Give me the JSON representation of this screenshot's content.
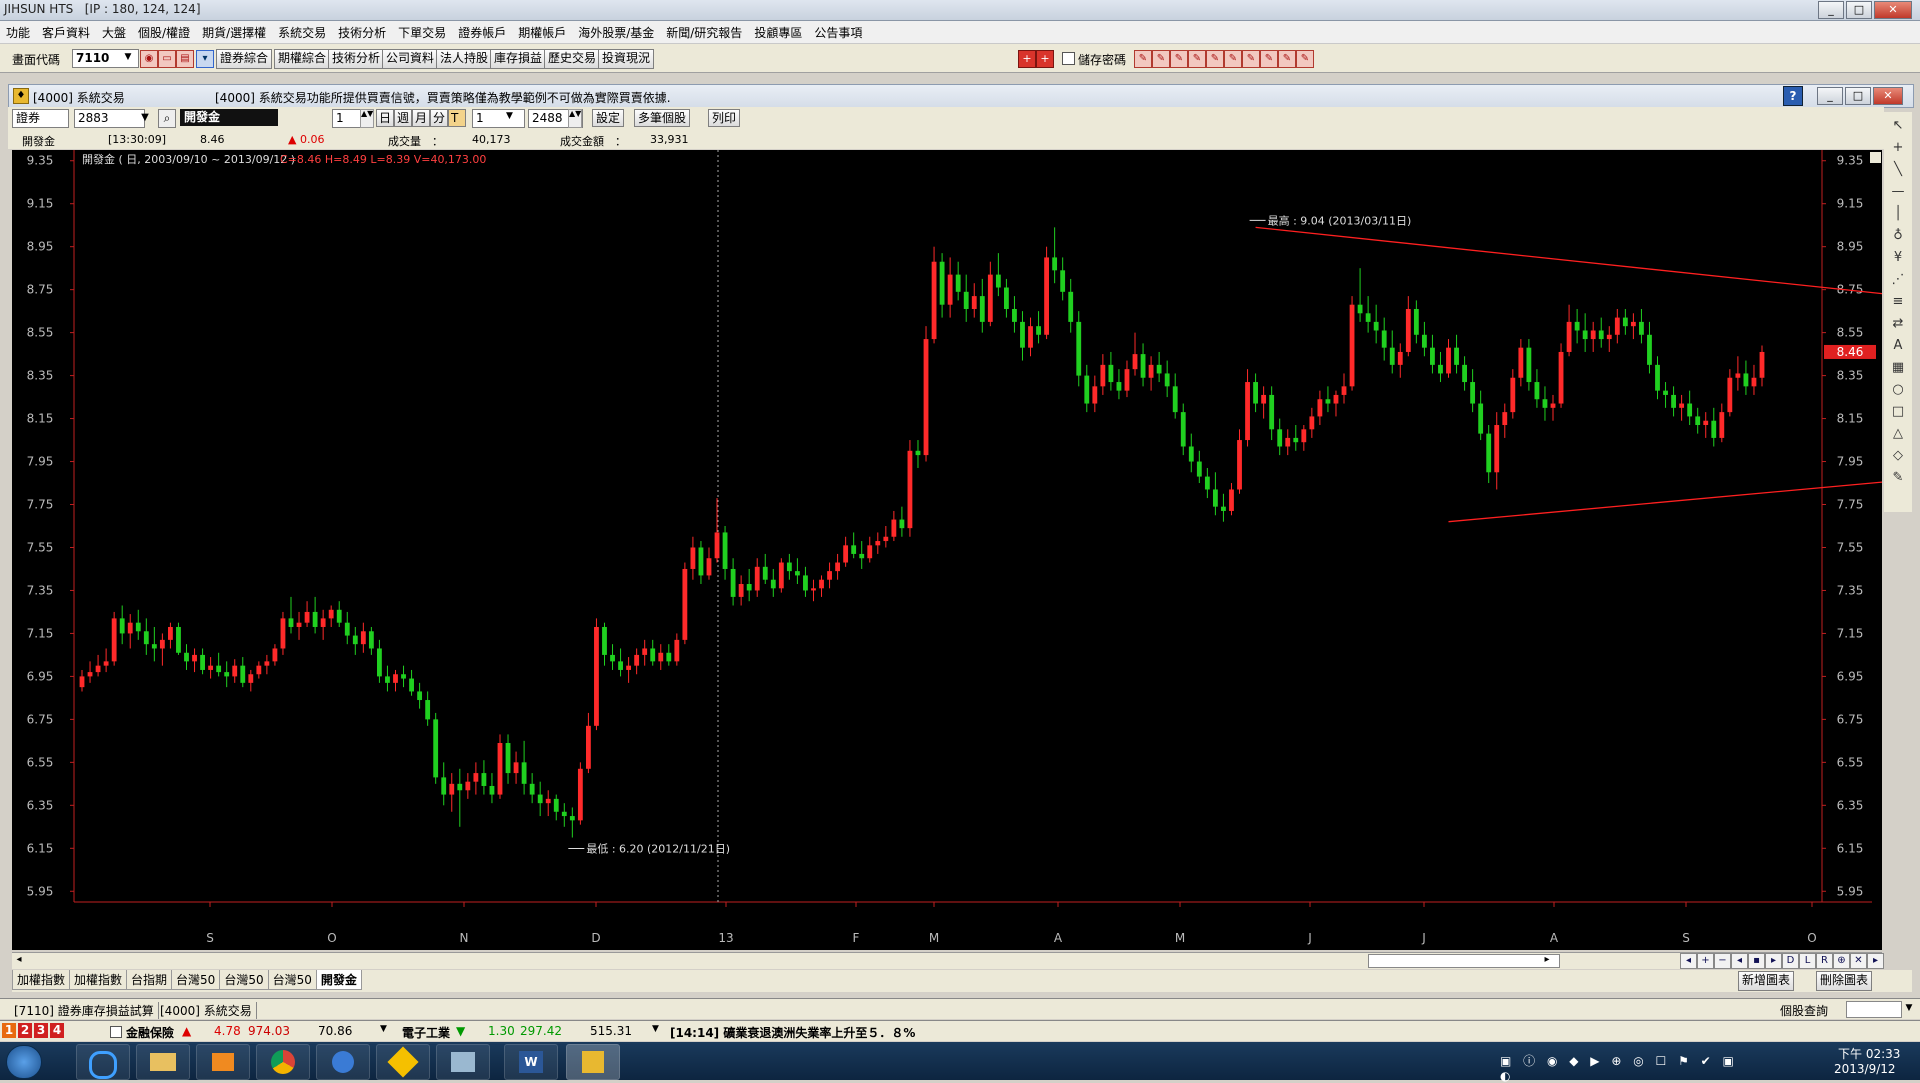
{
  "app": {
    "title": "JIHSUN HTS",
    "ip": "[IP : 180, 124, 124]"
  },
  "menu": [
    "功能",
    "客戶資料",
    "大盤",
    "個股/權證",
    "期貨/選擇權",
    "系統交易",
    "技術分析",
    "下單交易",
    "證券帳戶",
    "期權帳戶",
    "海外股票/基金",
    "新聞/研究報告",
    "投顧專區",
    "公告事項"
  ],
  "toolbar1": {
    "code_label": "畫面代碼",
    "code_value": "7110",
    "buttons": [
      "證券綜合",
      "期權綜合",
      "技術分析",
      "公司資料",
      "法人持股",
      "庫存損益",
      "歷史交易",
      "投資現況"
    ],
    "save_pwd": "儲存密碼"
  },
  "subwindow": {
    "title": "[4000] 系統交易",
    "notice": "[4000] 系統交易功能所提供買賣信號，買賣策略僅為教學範例不可做為實際買賣依據."
  },
  "toolbar2": {
    "market": "證券",
    "stock_code": "2883",
    "stock_name": "開發金",
    "period_value": "1",
    "period_buttons": [
      "日",
      "週",
      "月",
      "分",
      "T"
    ],
    "count_value": "1",
    "bars_value": "2488",
    "buttons": [
      "設定",
      "多筆個股",
      "列印"
    ]
  },
  "info": {
    "name": "開發金",
    "time": "[13:30:09]",
    "price": "8.46",
    "change": "▲ 0.06",
    "vol_label": "成交量　：",
    "vol_value": "40,173",
    "amt_label": "成交金額　：",
    "amt_value": "33,931"
  },
  "chart_data": {
    "type": "candlestick",
    "title": "開發金 ( 日, 2003/09/10 ~ 2013/09/12 )",
    "ohlc_text": "C=8.46 H=8.49 L=8.39 V=40,173.00",
    "yticks": [
      "9.35",
      "9.15",
      "8.95",
      "8.75",
      "8.55",
      "8.35",
      "8.15",
      "7.95",
      "7.75",
      "7.55",
      "7.35",
      "7.15",
      "6.95",
      "6.75",
      "6.55",
      "6.35",
      "6.15",
      "5.95"
    ],
    "ylim": [
      5.9,
      9.4
    ],
    "xticks": [
      "S",
      "O",
      "N",
      "D",
      "13",
      "F",
      "M",
      "A",
      "M",
      "J",
      "J",
      "A",
      "S",
      "O"
    ],
    "last_price": "8.46",
    "high_note": "最高 : 9.04 (2013/03/11日)",
    "low_note": "最低 : 6.20 (2012/11/21日)",
    "colors": {
      "up": "#ff2a2a",
      "down": "#20d020",
      "trend": "#ff2020",
      "axis": "#c02020"
    },
    "trendlines": [
      {
        "from": {
          "i": 146,
          "v": 9.04
        },
        "to": {
          "i": 290,
          "v": 8.47
        }
      },
      {
        "from": {
          "i": 170,
          "v": 7.67
        },
        "to": {
          "i": 290,
          "v": 8.08
        }
      }
    ],
    "candles": [
      [
        6.9,
        6.98,
        6.88,
        6.95
      ],
      [
        6.95,
        7.02,
        6.92,
        6.97
      ],
      [
        6.97,
        7.05,
        6.95,
        7.0
      ],
      [
        7.0,
        7.08,
        6.97,
        7.02
      ],
      [
        7.02,
        7.25,
        7.0,
        7.22
      ],
      [
        7.22,
        7.28,
        7.1,
        7.15
      ],
      [
        7.15,
        7.24,
        7.08,
        7.2
      ],
      [
        7.2,
        7.26,
        7.12,
        7.16
      ],
      [
        7.16,
        7.22,
        7.05,
        7.1
      ],
      [
        7.1,
        7.18,
        7.02,
        7.08
      ],
      [
        7.08,
        7.15,
        7.0,
        7.12
      ],
      [
        7.12,
        7.2,
        7.08,
        7.18
      ],
      [
        7.18,
        7.2,
        7.05,
        7.06
      ],
      [
        7.06,
        7.1,
        6.98,
        7.02
      ],
      [
        7.02,
        7.08,
        6.97,
        7.05
      ],
      [
        7.05,
        7.08,
        6.96,
        6.98
      ],
      [
        6.98,
        7.04,
        6.94,
        7.0
      ],
      [
        7.0,
        7.06,
        6.95,
        6.97
      ],
      [
        6.97,
        7.02,
        6.9,
        6.95
      ],
      [
        6.95,
        7.03,
        6.92,
        7.0
      ],
      [
        7.0,
        7.04,
        6.9,
        6.92
      ],
      [
        6.92,
        6.98,
        6.88,
        6.96
      ],
      [
        6.96,
        7.02,
        6.94,
        7.0
      ],
      [
        7.0,
        7.05,
        6.96,
        7.02
      ],
      [
        7.02,
        7.1,
        7.0,
        7.08
      ],
      [
        7.08,
        7.25,
        7.05,
        7.22
      ],
      [
        7.22,
        7.32,
        7.15,
        7.18
      ],
      [
        7.18,
        7.25,
        7.12,
        7.2
      ],
      [
        7.2,
        7.3,
        7.18,
        7.25
      ],
      [
        7.25,
        7.32,
        7.15,
        7.18
      ],
      [
        7.18,
        7.26,
        7.12,
        7.22
      ],
      [
        7.22,
        7.28,
        7.18,
        7.26
      ],
      [
        7.26,
        7.3,
        7.18,
        7.2
      ],
      [
        7.2,
        7.25,
        7.1,
        7.14
      ],
      [
        7.14,
        7.18,
        7.05,
        7.1
      ],
      [
        7.1,
        7.2,
        7.06,
        7.16
      ],
      [
        7.16,
        7.18,
        7.05,
        7.08
      ],
      [
        7.08,
        7.12,
        6.92,
        6.95
      ],
      [
        6.95,
        7.0,
        6.88,
        6.92
      ],
      [
        6.92,
        6.98,
        6.88,
        6.96
      ],
      [
        6.96,
        7.0,
        6.9,
        6.94
      ],
      [
        6.94,
        6.98,
        6.86,
        6.88
      ],
      [
        6.88,
        6.92,
        6.8,
        6.84
      ],
      [
        6.84,
        6.88,
        6.72,
        6.75
      ],
      [
        6.75,
        6.78,
        6.45,
        6.48
      ],
      [
        6.48,
        6.55,
        6.35,
        6.4
      ],
      [
        6.4,
        6.5,
        6.32,
        6.45
      ],
      [
        6.45,
        6.52,
        6.25,
        6.42
      ],
      [
        6.42,
        6.5,
        6.38,
        6.46
      ],
      [
        6.46,
        6.55,
        6.4,
        6.5
      ],
      [
        6.5,
        6.56,
        6.4,
        6.44
      ],
      [
        6.44,
        6.5,
        6.36,
        6.4
      ],
      [
        6.4,
        6.68,
        6.38,
        6.64
      ],
      [
        6.64,
        6.68,
        6.45,
        6.5
      ],
      [
        6.5,
        6.6,
        6.45,
        6.55
      ],
      [
        6.55,
        6.65,
        6.4,
        6.45
      ],
      [
        6.45,
        6.5,
        6.36,
        6.4
      ],
      [
        6.4,
        6.46,
        6.3,
        6.36
      ],
      [
        6.36,
        6.42,
        6.3,
        6.38
      ],
      [
        6.38,
        6.4,
        6.28,
        6.32
      ],
      [
        6.32,
        6.36,
        6.25,
        6.3
      ],
      [
        6.3,
        6.34,
        6.2,
        6.28
      ],
      [
        6.28,
        6.55,
        6.26,
        6.52
      ],
      [
        6.52,
        6.78,
        6.5,
        6.72
      ],
      [
        6.72,
        7.22,
        6.7,
        7.18
      ],
      [
        7.18,
        7.2,
        7.0,
        7.05
      ],
      [
        7.05,
        7.1,
        6.98,
        7.02
      ],
      [
        7.02,
        7.08,
        6.95,
        6.98
      ],
      [
        6.98,
        7.04,
        6.92,
        7.0
      ],
      [
        7.0,
        7.08,
        6.96,
        7.05
      ],
      [
        7.05,
        7.12,
        7.0,
        7.08
      ],
      [
        7.08,
        7.12,
        7.0,
        7.02
      ],
      [
        7.02,
        7.1,
        6.98,
        7.06
      ],
      [
        7.06,
        7.1,
        7.0,
        7.02
      ],
      [
        7.02,
        7.15,
        7.0,
        7.12
      ],
      [
        7.12,
        7.48,
        7.1,
        7.45
      ],
      [
        7.45,
        7.6,
        7.4,
        7.55
      ],
      [
        7.55,
        7.58,
        7.38,
        7.42
      ],
      [
        7.42,
        7.55,
        7.4,
        7.5
      ],
      [
        7.5,
        7.78,
        7.48,
        7.62
      ],
      [
        7.62,
        7.65,
        7.4,
        7.45
      ],
      [
        7.45,
        7.5,
        7.28,
        7.32
      ],
      [
        7.32,
        7.42,
        7.28,
        7.38
      ],
      [
        7.38,
        7.45,
        7.3,
        7.35
      ],
      [
        7.35,
        7.5,
        7.32,
        7.46
      ],
      [
        7.46,
        7.52,
        7.38,
        7.4
      ],
      [
        7.4,
        7.45,
        7.32,
        7.36
      ],
      [
        7.36,
        7.5,
        7.34,
        7.48
      ],
      [
        7.48,
        7.52,
        7.4,
        7.44
      ],
      [
        7.44,
        7.5,
        7.38,
        7.42
      ],
      [
        7.42,
        7.46,
        7.32,
        7.35
      ],
      [
        7.35,
        7.4,
        7.3,
        7.36
      ],
      [
        7.36,
        7.42,
        7.32,
        7.4
      ],
      [
        7.4,
        7.48,
        7.36,
        7.44
      ],
      [
        7.44,
        7.52,
        7.4,
        7.48
      ],
      [
        7.48,
        7.6,
        7.46,
        7.56
      ],
      [
        7.56,
        7.62,
        7.5,
        7.52
      ],
      [
        7.52,
        7.58,
        7.45,
        7.5
      ],
      [
        7.5,
        7.6,
        7.48,
        7.56
      ],
      [
        7.56,
        7.62,
        7.52,
        7.58
      ],
      [
        7.58,
        7.65,
        7.55,
        7.6
      ],
      [
        7.6,
        7.72,
        7.58,
        7.68
      ],
      [
        7.68,
        7.74,
        7.6,
        7.64
      ],
      [
        7.64,
        8.05,
        7.6,
        8.0
      ],
      [
        8.0,
        8.05,
        7.92,
        7.98
      ],
      [
        7.98,
        8.58,
        7.95,
        8.52
      ],
      [
        8.52,
        8.95,
        8.5,
        8.88
      ],
      [
        8.88,
        8.92,
        8.62,
        8.68
      ],
      [
        8.68,
        8.9,
        8.62,
        8.82
      ],
      [
        8.82,
        8.88,
        8.7,
        8.74
      ],
      [
        8.74,
        8.82,
        8.6,
        8.66
      ],
      [
        8.66,
        8.78,
        8.62,
        8.72
      ],
      [
        8.72,
        8.8,
        8.55,
        8.6
      ],
      [
        8.6,
        8.88,
        8.58,
        8.82
      ],
      [
        8.82,
        8.92,
        8.72,
        8.76
      ],
      [
        8.76,
        8.8,
        8.62,
        8.66
      ],
      [
        8.66,
        8.72,
        8.55,
        8.6
      ],
      [
        8.6,
        8.65,
        8.42,
        8.48
      ],
      [
        8.48,
        8.62,
        8.44,
        8.58
      ],
      [
        8.58,
        8.65,
        8.5,
        8.54
      ],
      [
        8.54,
        8.95,
        8.52,
        8.9
      ],
      [
        8.9,
        9.04,
        8.78,
        8.84
      ],
      [
        8.84,
        8.9,
        8.7,
        8.74
      ],
      [
        8.74,
        8.8,
        8.55,
        8.6
      ],
      [
        8.6,
        8.65,
        8.3,
        8.35
      ],
      [
        8.35,
        8.4,
        8.18,
        8.22
      ],
      [
        8.22,
        8.35,
        8.18,
        8.3
      ],
      [
        8.3,
        8.45,
        8.26,
        8.4
      ],
      [
        8.4,
        8.46,
        8.28,
        8.32
      ],
      [
        8.32,
        8.38,
        8.24,
        8.28
      ],
      [
        8.28,
        8.42,
        8.25,
        8.38
      ],
      [
        8.38,
        8.55,
        8.35,
        8.45
      ],
      [
        8.45,
        8.5,
        8.3,
        8.34
      ],
      [
        8.34,
        8.44,
        8.28,
        8.4
      ],
      [
        8.4,
        8.46,
        8.32,
        8.36
      ],
      [
        8.36,
        8.42,
        8.25,
        8.3
      ],
      [
        8.3,
        8.36,
        8.15,
        8.18
      ],
      [
        8.18,
        8.22,
        7.98,
        8.02
      ],
      [
        8.02,
        8.08,
        7.9,
        7.95
      ],
      [
        7.95,
        8.0,
        7.85,
        7.88
      ],
      [
        7.88,
        7.92,
        7.78,
        7.82
      ],
      [
        7.82,
        7.9,
        7.7,
        7.74
      ],
      [
        7.74,
        7.8,
        7.67,
        7.72
      ],
      [
        7.72,
        7.85,
        7.7,
        7.82
      ],
      [
        7.82,
        8.1,
        7.8,
        8.05
      ],
      [
        8.05,
        8.38,
        8.02,
        8.32
      ],
      [
        8.32,
        8.36,
        8.18,
        8.22
      ],
      [
        8.22,
        8.3,
        8.15,
        8.26
      ],
      [
        8.26,
        8.3,
        8.05,
        8.1
      ],
      [
        8.1,
        8.15,
        7.98,
        8.02
      ],
      [
        8.02,
        8.1,
        7.98,
        8.06
      ],
      [
        8.06,
        8.12,
        8.0,
        8.04
      ],
      [
        8.04,
        8.12,
        8.0,
        8.1
      ],
      [
        8.1,
        8.2,
        8.06,
        8.16
      ],
      [
        8.16,
        8.28,
        8.12,
        8.24
      ],
      [
        8.24,
        8.3,
        8.18,
        8.22
      ],
      [
        8.22,
        8.28,
        8.16,
        8.26
      ],
      [
        8.26,
        8.36,
        8.22,
        8.3
      ],
      [
        8.3,
        8.72,
        8.28,
        8.68
      ],
      [
        8.68,
        8.85,
        8.6,
        8.64
      ],
      [
        8.64,
        8.72,
        8.55,
        8.6
      ],
      [
        8.6,
        8.68,
        8.5,
        8.56
      ],
      [
        8.56,
        8.62,
        8.42,
        8.48
      ],
      [
        8.48,
        8.56,
        8.36,
        8.4
      ],
      [
        8.4,
        8.5,
        8.34,
        8.46
      ],
      [
        8.46,
        8.72,
        8.44,
        8.66
      ],
      [
        8.66,
        8.7,
        8.5,
        8.54
      ],
      [
        8.54,
        8.6,
        8.44,
        8.48
      ],
      [
        8.48,
        8.54,
        8.36,
        8.4
      ],
      [
        8.4,
        8.46,
        8.32,
        8.36
      ],
      [
        8.36,
        8.52,
        8.34,
        8.48
      ],
      [
        8.48,
        8.54,
        8.36,
        8.4
      ],
      [
        8.4,
        8.44,
        8.28,
        8.32
      ],
      [
        8.32,
        8.38,
        8.18,
        8.22
      ],
      [
        8.22,
        8.28,
        8.05,
        8.08
      ],
      [
        8.08,
        8.12,
        7.85,
        7.9
      ],
      [
        7.9,
        8.18,
        7.82,
        8.12
      ],
      [
        8.12,
        8.22,
        8.06,
        8.18
      ],
      [
        8.18,
        8.38,
        8.15,
        8.34
      ],
      [
        8.34,
        8.52,
        8.3,
        8.48
      ],
      [
        8.48,
        8.52,
        8.28,
        8.32
      ],
      [
        8.32,
        8.38,
        8.2,
        8.24
      ],
      [
        8.24,
        8.3,
        8.14,
        8.2
      ],
      [
        8.2,
        8.26,
        8.14,
        8.22
      ],
      [
        8.22,
        8.5,
        8.2,
        8.46
      ],
      [
        8.46,
        8.68,
        8.44,
        8.6
      ],
      [
        8.6,
        8.66,
        8.5,
        8.56
      ],
      [
        8.56,
        8.64,
        8.46,
        8.52
      ],
      [
        8.52,
        8.6,
        8.46,
        8.56
      ],
      [
        8.56,
        8.62,
        8.48,
        8.52
      ],
      [
        8.52,
        8.58,
        8.46,
        8.54
      ],
      [
        8.54,
        8.66,
        8.5,
        8.62
      ],
      [
        8.62,
        8.66,
        8.54,
        8.58
      ],
      [
        8.58,
        8.64,
        8.52,
        8.6
      ],
      [
        8.6,
        8.66,
        8.5,
        8.54
      ],
      [
        8.54,
        8.6,
        8.36,
        8.4
      ],
      [
        8.4,
        8.44,
        8.24,
        8.28
      ],
      [
        8.28,
        8.32,
        8.2,
        8.26
      ],
      [
        8.26,
        8.3,
        8.16,
        8.2
      ],
      [
        8.2,
        8.26,
        8.14,
        8.22
      ],
      [
        8.22,
        8.28,
        8.12,
        8.16
      ],
      [
        8.16,
        8.2,
        8.08,
        8.12
      ],
      [
        8.12,
        8.18,
        8.06,
        8.14
      ],
      [
        8.14,
        8.2,
        8.02,
        8.06
      ],
      [
        8.06,
        8.22,
        8.04,
        8.18
      ],
      [
        8.18,
        8.38,
        8.16,
        8.34
      ],
      [
        8.34,
        8.44,
        8.28,
        8.36
      ],
      [
        8.36,
        8.42,
        8.26,
        8.3
      ],
      [
        8.3,
        8.4,
        8.26,
        8.34
      ],
      [
        8.34,
        8.49,
        8.3,
        8.46
      ]
    ]
  },
  "rtools": [
    "↖",
    "+",
    "╲",
    "—",
    "│",
    "♁",
    "¥",
    "⋰",
    "≡",
    "⇄",
    "A",
    "▦",
    "○",
    "□",
    "△",
    "◇",
    "✎"
  ],
  "nav_buttons": [
    "◂",
    "+",
    "−",
    "◂",
    "▪",
    "▸",
    "D",
    "L",
    "R",
    "⊕",
    "✕",
    "▸"
  ],
  "tabs": [
    "加權指數",
    "加權指數",
    "台指期",
    "台灣50",
    "台灣50",
    "台灣50",
    "開發金"
  ],
  "tab_buttons": [
    "新增圖表",
    "刪除圖表"
  ],
  "status": {
    "items": [
      "[7110] 證券庫存損益試算",
      "[4000] 系統交易"
    ],
    "right": "個股查詢"
  },
  "ticker": {
    "nums": [
      "1",
      "2",
      "3",
      "4"
    ],
    "a_name": "金融保險",
    "a_arrow": "▲",
    "a_change": "4.78",
    "a_value": "974.03",
    "a_extra": "70.86",
    "b_name": "電子工業",
    "b_arrow": "▼",
    "b_change": "1.30",
    "b_value": "297.42",
    "b_extra": "515.31",
    "news": "[14:14] 礦業衰退澳洲失業率上升至５．８%"
  },
  "clock": {
    "time": "下午 02:33",
    "date": "2013/9/12"
  }
}
